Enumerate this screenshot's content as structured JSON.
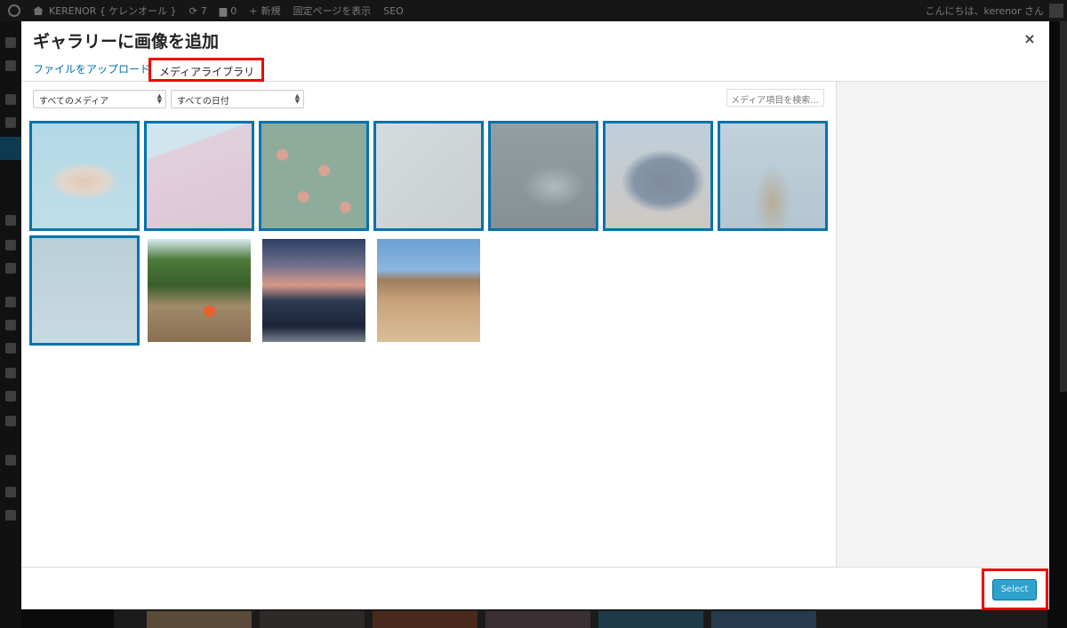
{
  "admin_bar": {
    "site_name": "KERENOR { ケレンオール }",
    "updates_count": "7",
    "comments_count": "0",
    "new_label": "新規",
    "view_page_label": "固定ページを表示",
    "seo_label": "SEO",
    "greeting": "こんにちは、kerenor さん"
  },
  "modal": {
    "title": "ギャラリーに画像を追加",
    "close_glyph": "×",
    "tabs": {
      "upload": "ファイルをアップロード",
      "library": "メディアライブラリ"
    },
    "filters": {
      "media_type": "すべてのメディア",
      "date": "すべての日付",
      "search_placeholder": "メディア項目を検索..."
    },
    "select_button": "Select"
  },
  "attachments": [
    {
      "name": "clouds-photo",
      "selected": true
    },
    {
      "name": "pink-house-photo",
      "selected": true
    },
    {
      "name": "orange-tree-photo",
      "selected": true
    },
    {
      "name": "map-photo",
      "selected": true
    },
    {
      "name": "cat-photo",
      "selected": true
    },
    {
      "name": "blueberries-photo",
      "selected": true
    },
    {
      "name": "woman-sea-photo",
      "selected": true
    },
    {
      "name": "palm-tree-photo",
      "selected": true
    },
    {
      "name": "picnic-group-photo",
      "selected": false
    },
    {
      "name": "sunset-sea-photo",
      "selected": false
    },
    {
      "name": "desert-hill-photo",
      "selected": false
    }
  ],
  "colors": {
    "accent": "#0073aa",
    "button": "#2ea2cc",
    "highlight_box": "#e00000"
  }
}
